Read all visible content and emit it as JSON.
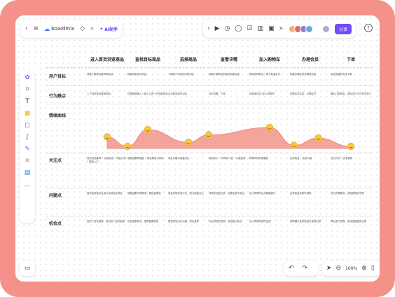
{
  "toolbar": {
    "brand": "boardmix",
    "ai_label": "AI助手",
    "share_label": "分享",
    "help": "?"
  },
  "zoom": {
    "level": "100%"
  },
  "map": {
    "stages": [
      "进入首页浏览商品",
      "查找目标商品",
      "选择商品",
      "查看详情",
      "加入购物车",
      "办理会员",
      "下单"
    ],
    "rows": [
      "用户目标",
      "行为触点",
      "情绪曲线",
      "关注点",
      "问题点",
      "机会点"
    ],
    "goals": [
      "快速了解商品推荐和活动",
      "精准找到目标商品",
      "了解各个商品的价格对比",
      "详细了解商品的各项功能信息",
      "暂存选购商品，便于批量支付",
      "知道办理会员有哪些权益",
      "安全快捷的完成下单"
    ],
    "touchpoints": [
      "上下浏览首页推荐商品",
      "在搜索框输入一键入口进一步搜索商品",
      "点击商品进行对比",
      "评价查看、下单",
      "商品添加至“加入购物车”",
      "查看会员权益、办理会员",
      "确认订单信息、选择支付方式完成支付"
    ],
    "emotion": {
      "points": [
        {
          "stage": 1,
          "level": 0.55,
          "mood": "neutral"
        },
        {
          "stage": 1.5,
          "level": 0.1,
          "mood": "sad"
        },
        {
          "stage": 2,
          "level": 0.9,
          "mood": "happy"
        },
        {
          "stage": 3,
          "level": 0.3,
          "mood": "neutral"
        },
        {
          "stage": 3.5,
          "level": 0.65,
          "mood": "happy"
        },
        {
          "stage": 5,
          "level": 1.0,
          "mood": "happy"
        },
        {
          "stage": 5.6,
          "level": 0.15,
          "mood": "sad"
        },
        {
          "stage": 6.2,
          "level": 0.5,
          "mood": "happy"
        },
        {
          "stage": 7,
          "level": 0.1,
          "mood": "sad"
        }
      ]
    },
    "focus": [
      "首页商品推荐 • 活动信息 • 商品分类 • 搜索入口",
      "搜索结果精准度 • 商品筛选与排序",
      "商品价格与销量对比",
      "商品评价 • 详情页介绍 • 价格优惠",
      "购物车操作便捷性",
      "会员权益 • 会员价格",
      "支付方式 • 优惠使用"
    ],
    "problems": [
      "首页信息较杂乱难以找到目标商品",
      "搜索结果不够精准，需反复筛选",
      "商品详情信息冗长，难以快速对比",
      "详情页信息过多，关键信息不突出",
      "加入购物车后未明确提示",
      "会员权益说明不清晰",
      "支付步骤繁琐，优惠券使用不便"
    ],
    "opportunities": [
      "首页个性化推荐，突出热门活动信息",
      "优化搜索算法，提供智能筛选",
      "提供商品对比功能，突出差异",
      "优化详情页结构，突出核心卖点",
      "加入购物车即时反馈",
      "清晰展示会员权益与省钱计算",
      "简化支付流程，自动匹配最优优惠"
    ]
  }
}
